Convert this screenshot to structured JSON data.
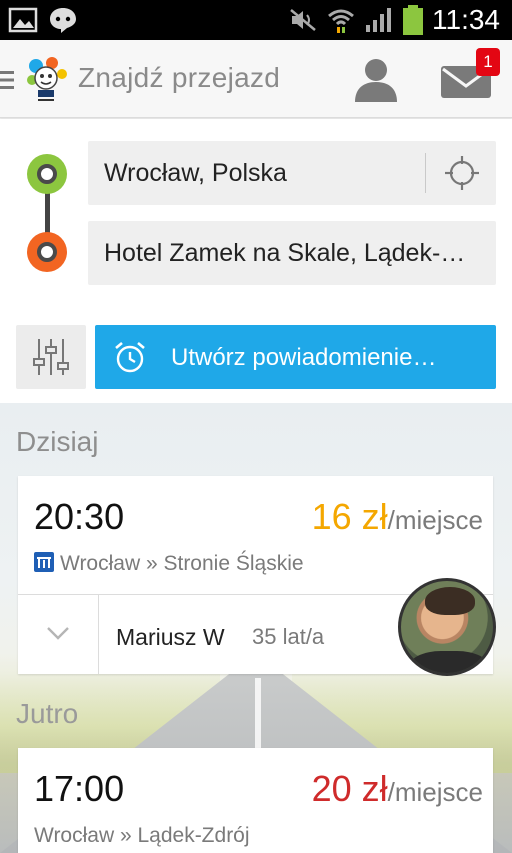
{
  "status_bar": {
    "time": "11:34",
    "icons": [
      "image-icon",
      "chat-icon",
      "mute-icon",
      "wifi-icon",
      "signal-icon",
      "battery-icon"
    ]
  },
  "app_bar": {
    "title": "Znajdź przejazd",
    "mail_badge": "1"
  },
  "search": {
    "from": "Wrocław, Polska",
    "to": "Hotel Zamek na Skale, Lądek-…",
    "notify_label": "Utwórz powiadomienie…"
  },
  "sections": {
    "today": "Dzisiaj",
    "tomorrow": "Jutro"
  },
  "rides": [
    {
      "time": "20:30",
      "price": "16 zł",
      "price_unit": "/miejsce",
      "route": "Wrocław » Stronie Śląskie",
      "driver_name": "Mariusz W",
      "driver_age": "35 lat/a"
    },
    {
      "time": "17:00",
      "price": "20 zł",
      "price_unit": "/miejsce",
      "route": "Wrocław » Lądek-Zdrój"
    }
  ],
  "colors": {
    "accent_blue": "#1fa8e8",
    "from_dot": "#8cc63f",
    "to_dot": "#f26522",
    "price_orange": "#f4a700",
    "price_red": "#cf2b2b",
    "badge_red": "#e30613"
  }
}
